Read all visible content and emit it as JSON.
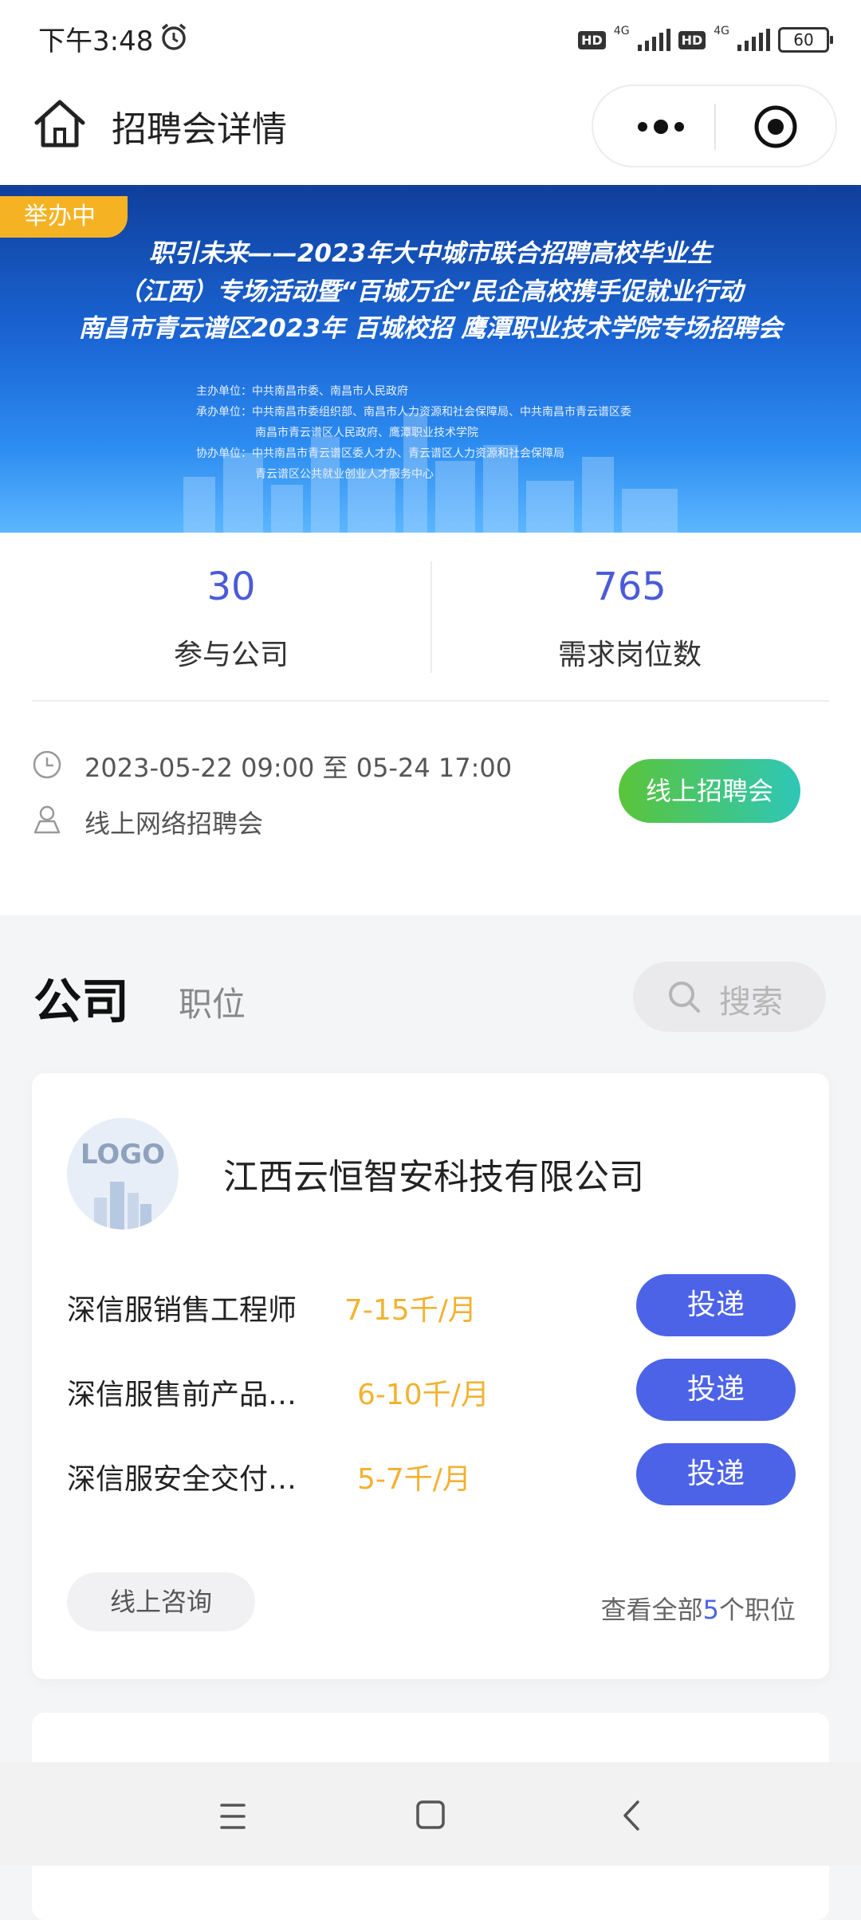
{
  "status_bar": {
    "time": "下午3:48",
    "network1": "4G",
    "network2": "4G",
    "hd1": "HD",
    "hd2": "HD",
    "battery": "60",
    "icons": [
      "alarm-icon",
      "hd-icon",
      "signal-icon",
      "battery-icon"
    ]
  },
  "navbar": {
    "title": "招聘会详情",
    "home_icon": "home-icon",
    "more_icon": "more-icon",
    "target_icon": "target-icon"
  },
  "banner": {
    "badge": "举办中",
    "line1": "职引未来——2023年大中城市联合招聘高校毕业生",
    "line2": "（江西）专场活动暨“百城万企”民企高校携手促就业行动",
    "line3": "南昌市青云谱区2023年 百城校招 鹰潭职业技术学院专场招聘会",
    "org1": "主办单位：中共南昌市委、南昌市人民政府",
    "org2": "承办单位：中共南昌市委组织部、南昌市人力资源和社会保障局、中共南昌市青云谱区委",
    "org3": "南昌市青云谱区人民政府、鹰潭职业技术学院",
    "org4": "协办单位：中共南昌市青云谱区委人才办、青云谱区人力资源和社会保障局",
    "org5": "青云谱区公共就业创业人才服务中心"
  },
  "stats": {
    "companies_value": "30",
    "companies_label": "参与公司",
    "positions_value": "765",
    "positions_label": "需求岗位数"
  },
  "event": {
    "time": "2023-05-22 09:00  至  05-24 17:00",
    "place": "线上网络招聘会",
    "online_button": "线上招聘会"
  },
  "tabs": {
    "active": "公司",
    "inactive": "职位",
    "search_placeholder": "搜索"
  },
  "company": {
    "logo_text": "LOGO",
    "name": "江西云恒智安科技有限公司",
    "jobs": [
      {
        "title": "深信服销售工程师",
        "salary": "7-15千/月",
        "button": "投递"
      },
      {
        "title": "深信服售前产品…",
        "salary": "6-10千/月",
        "button": "投递"
      },
      {
        "title": "深信服安全交付…",
        "salary": "5-7千/月",
        "button": "投递"
      }
    ],
    "consult_button": "线上咨询",
    "view_all_prefix": "查看全部",
    "view_all_count": "5",
    "view_all_suffix": "个职位"
  },
  "bottom_nav": {
    "icons": [
      "menu-icon",
      "home-square-icon",
      "back-icon"
    ]
  },
  "colors": {
    "accent": "#4c63e8",
    "salary": "#f2b230",
    "badge": "#f5b324",
    "online_start": "#5ac53a",
    "online_end": "#2ec6b7"
  }
}
